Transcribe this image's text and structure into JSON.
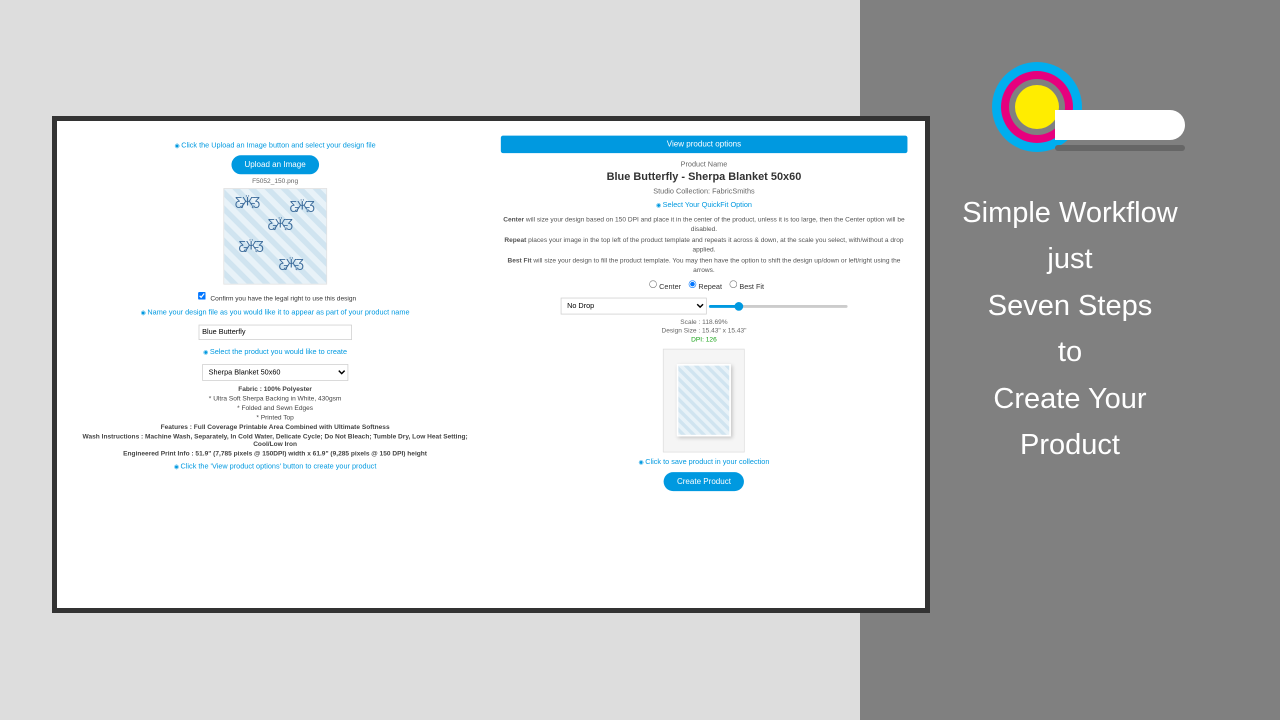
{
  "tagline": {
    "l1": "Simple Workflow",
    "l2": "just",
    "l3": "Seven Steps",
    "l4": "to",
    "l5": "Create Your",
    "l6": "Product"
  },
  "left": {
    "step1": "Click the Upload an Image button and select your design file",
    "uploadBtn": "Upload an Image",
    "filename": "F5052_150.png",
    "confirm": "Confirm you have the legal right to use this design",
    "step2": "Name your design file as you would like it to appear as part of your product name",
    "nameValue": "Blue Butterfly",
    "step3": "Select the product you would like to create",
    "productSel": "Sherpa Blanket 50x60",
    "fabric": "Fabric : 100% Polyester",
    "spec1": "* Ultra Soft Sherpa Backing in White, 430gsm",
    "spec2": "* Folded and Sewn Edges",
    "spec3": "* Printed Top",
    "features": "Features : Full Coverage Printable Area Combined with Ultimate Softness",
    "wash": "Wash Instructions : Machine Wash, Separately, In Cold Water, Delicate Cycle; Do Not Bleach; Tumble Dry, Low Heat Setting; Cool/Low Iron",
    "print": "Engineered Print Info : 51.9\" (7,785 pixels @ 150DPI) width x 61.9\" (9,285 pixels @ 150 DPI) height",
    "step4": "Click the 'View product options' button to create your product"
  },
  "right": {
    "viewBtn": "View product options",
    "pnLabel": "Product Name",
    "title": "Blue Butterfly - Sherpa Blanket 50x60",
    "studio": "Studio Collection: FabricSmiths",
    "step5": "Select Your QuickFit Option",
    "centerDesc": "Center will size your design based on 150 DPI and place it in the center of the product, unless it is too large, then the Center option will be disabled.",
    "repeatDesc": "Repeat places your image in the top left of the product template and repeats it across & down, at the scale you select, with/without a drop applied.",
    "bestfitDesc": "Best Fit will size your design to fill the product template. You may then have the option to shift the design up/down or left/right using the arrows.",
    "opt1": "Center",
    "opt2": "Repeat",
    "opt3": "Best Fit",
    "dropSel": "No Drop",
    "scale": "Scale : 118.69%",
    "size": "Design Size : 15.43\" x 15.43\"",
    "dpi": "DPI: 126",
    "step6": "Click to save product in your collection",
    "createBtn": "Create Product"
  }
}
